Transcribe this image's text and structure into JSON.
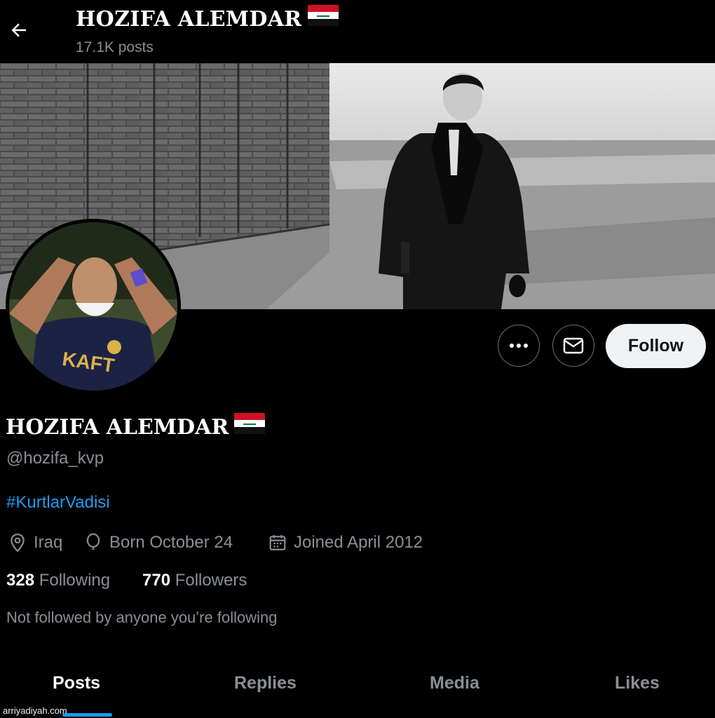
{
  "header": {
    "title": "HOZIFA ALEMDAR",
    "posts_count": "17.1K posts"
  },
  "profile": {
    "display_name": "HOZIFA ALEMDAR",
    "handle": "@hozifa_kvp",
    "bio_hashtag": "#KurtlarVadisi",
    "location": "Iraq",
    "birthday": "Born October 24",
    "joined": "Joined April 2012",
    "following_count": "328",
    "following_label": "Following",
    "followers_count": "770",
    "followers_label": "Followers",
    "mutuals_note": "Not followed by anyone you’re following"
  },
  "actions": {
    "follow_label": "Follow",
    "more_icon": "more-dots-icon",
    "message_icon": "envelope-icon"
  },
  "tabs": [
    {
      "label": "Posts",
      "active": true
    },
    {
      "label": "Replies",
      "active": false
    },
    {
      "label": "Media",
      "active": false
    },
    {
      "label": "Likes",
      "active": false
    }
  ],
  "colors": {
    "background": "#000000",
    "link": "#1d9bf0",
    "muted": "#8b8f94",
    "follow_button": "#eff3f4"
  },
  "watermark": "arriyadiyah.com"
}
